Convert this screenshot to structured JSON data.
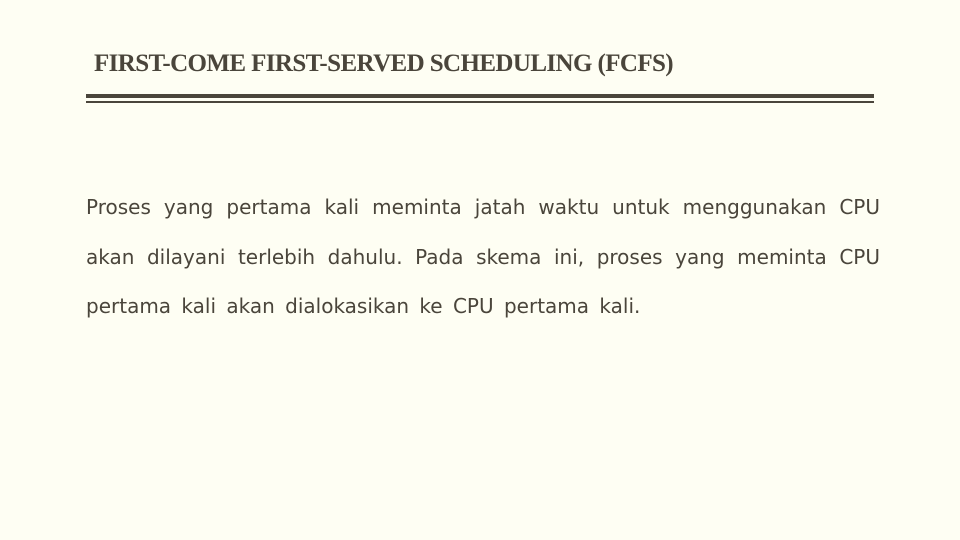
{
  "slide": {
    "title": "FIRST-COME FIRST-SERVED SCHEDULING (FCFS)",
    "paragraph": "Proses yang pertama kali meminta jatah waktu untuk menggunakan CPU akan dilayani terlebih dahulu. Pada skema ini, proses yang meminta CPU pertama kali akan dialokasikan ke CPU pertama kali."
  },
  "colors": {
    "background": "#fefef3",
    "text": "#4a453b",
    "rule": "#4a453b"
  }
}
